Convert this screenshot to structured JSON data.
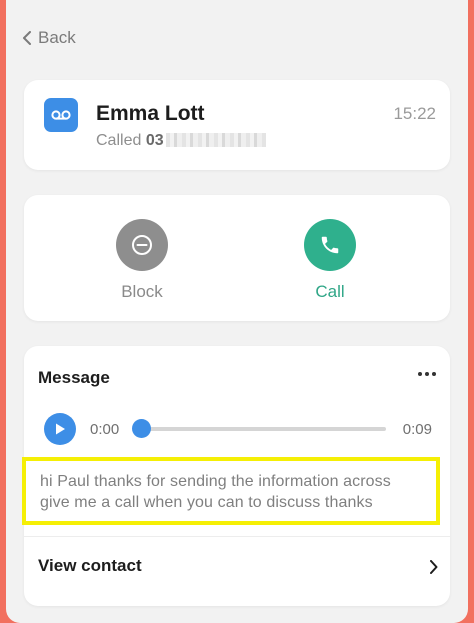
{
  "nav": {
    "back_label": "Back"
  },
  "caller": {
    "name": "Emma Lott",
    "called_prefix": "Called",
    "number_visible": "03",
    "time": "15:22"
  },
  "actions": {
    "block_label": "Block",
    "call_label": "Call"
  },
  "message": {
    "title": "Message",
    "player": {
      "current_time": "0:00",
      "duration": "0:09",
      "progress": 0.0
    },
    "transcript_lines": [
      "hi Paul thanks for sending the information across",
      "give me a call when you can to discuss thanks"
    ],
    "view_contact_label": "View contact"
  },
  "colors": {
    "frame": "#f2705f",
    "accent_blue": "#3d8ee6",
    "call_green": "#2fb08d",
    "block_gray": "#8e8e8e",
    "highlight": "#f5ef05"
  }
}
